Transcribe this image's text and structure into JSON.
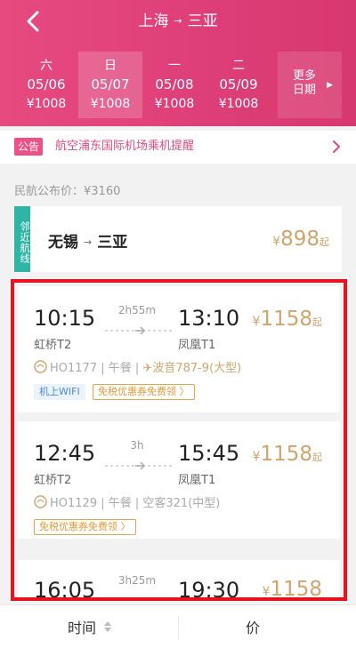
{
  "header": {
    "from_city": "上海",
    "arrow": "→",
    "to_city": "三亚",
    "dates": [
      {
        "weekday": "六",
        "date": "05/06",
        "price": "¥1008",
        "selected": false
      },
      {
        "weekday": "日",
        "date": "05/07",
        "price": "¥1008",
        "selected": true
      },
      {
        "weekday": "一",
        "date": "05/08",
        "price": "¥1008",
        "selected": false
      },
      {
        "weekday": "二",
        "date": "05/09",
        "price": "¥1008",
        "selected": false
      }
    ],
    "more_line1": "更多",
    "more_line2": "日期"
  },
  "notice": {
    "tag": "公告",
    "text": "航空浦东国际机场乘机提醒"
  },
  "public_price": "民航公布价：¥3160",
  "nearby": {
    "tag": "邻近航线",
    "from": "无锡",
    "arrow": "→",
    "to": "三亚",
    "price_symbol": "¥",
    "price": "898",
    "price_suffix": "起"
  },
  "flights": [
    {
      "depart_time": "10:15",
      "depart_airport": "虹桥T2",
      "duration": "2h55m",
      "arrive_time": "13:10",
      "arrive_airport": "凤凰T1",
      "price_symbol": "¥",
      "price": "1158",
      "price_suffix": "起",
      "info": "HO1177 | 午餐 | ",
      "aircraft": "波音787-9(大型)",
      "wifi": "机上WIFI",
      "coupon": "免税优惠券免费领 〉"
    },
    {
      "depart_time": "12:45",
      "depart_airport": "虹桥T2",
      "duration": "3h",
      "arrive_time": "15:45",
      "arrive_airport": "凤凰T1",
      "price_symbol": "¥",
      "price": "1158",
      "price_suffix": "起",
      "info": "HO1129 | 午餐 | 空客321(中型)",
      "coupon": "免税优惠券免费领 〉"
    },
    {
      "depart_time": "16:05",
      "duration": "3h25m",
      "arrive_time": "19:30",
      "price_symbol": "¥",
      "price": "1158"
    }
  ],
  "tabbar": {
    "sort_time": "时间",
    "sort_price": "价"
  },
  "colors": {
    "brand": "#e64a7f",
    "price": "#d1a46e",
    "highlight_frame": "#e8131e",
    "nearby_tag": "#2fb5a6"
  }
}
